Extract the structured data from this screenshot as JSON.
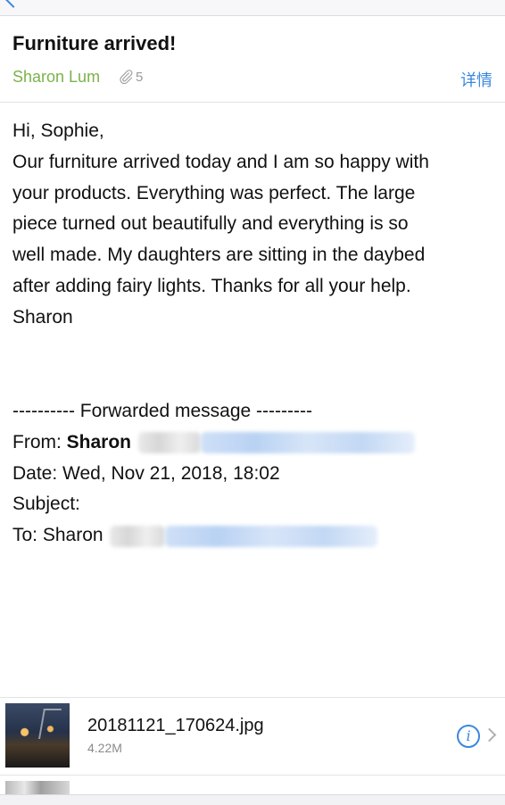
{
  "message": {
    "subject": "Furniture arrived!",
    "sender": "Sharon Lum",
    "attachment_count": "5",
    "details_label": "详情"
  },
  "body_lines": [
    "Hi, Sophie,",
    "Our furniture arrived today and I am so happy with",
    "your products. Everything was perfect.  The large",
    "piece turned out beautifully and everything is so",
    "well made. My daughters are sitting in the daybed",
    "after adding fairy lights. Thanks for all your help.",
    "Sharon"
  ],
  "forwarded": {
    "header": "---------- Forwarded message ---------",
    "from_label": "From:",
    "from_name": "Sharon",
    "date_line": "Date: Wed, Nov 21, 2018, 18:02",
    "subject_line": "Subject:",
    "to_label": "To: Sharon"
  },
  "attachments": [
    {
      "name": "20181121_170624.jpg",
      "size": "4.22M"
    }
  ],
  "colors": {
    "accent": "#3a87e0",
    "sender": "#7bb24a"
  },
  "icons": [
    "back-chevron-icon",
    "paperclip-icon",
    "info-icon",
    "chevron-right-icon"
  ]
}
